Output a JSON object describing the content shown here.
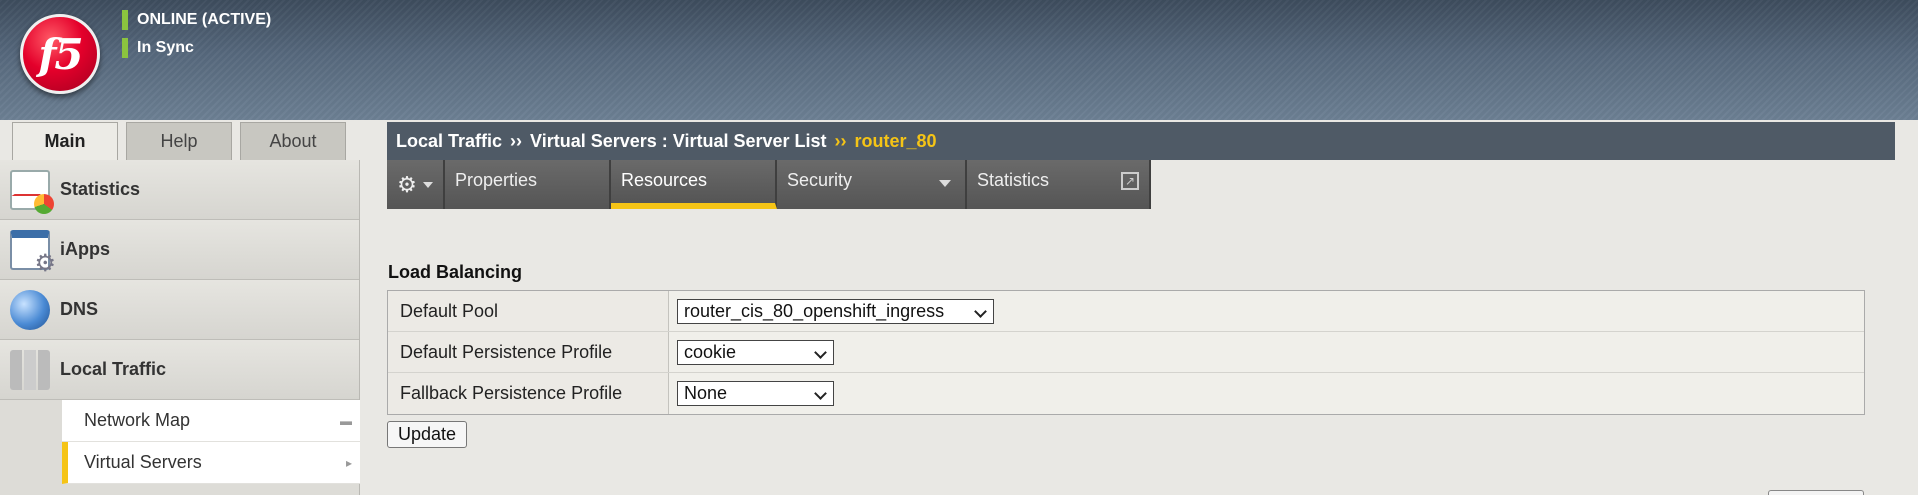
{
  "header": {
    "status_online": "ONLINE (ACTIVE)",
    "status_sync": "In Sync",
    "logo_text": "f5"
  },
  "top_tabs": [
    {
      "label": "Main",
      "active": true
    },
    {
      "label": "Help",
      "active": false
    },
    {
      "label": "About",
      "active": false
    }
  ],
  "sidebar": {
    "items": [
      {
        "label": "Statistics",
        "icon": "statistics-icon"
      },
      {
        "label": "iApps",
        "icon": "iapps-icon"
      },
      {
        "label": "DNS",
        "icon": "dns-globe-icon"
      },
      {
        "label": "Local Traffic",
        "icon": "local-traffic-icon"
      }
    ],
    "sub_items": [
      {
        "label": "Network Map"
      },
      {
        "label": "Virtual Servers"
      }
    ]
  },
  "breadcrumb": {
    "part1": "Local Traffic",
    "sep": "››",
    "part2": "Virtual Servers : Virtual Server List",
    "current": "router_80"
  },
  "subnav": {
    "properties": "Properties",
    "resources": "Resources",
    "security": "Security",
    "statistics": "Statistics"
  },
  "load_balancing": {
    "title": "Load Balancing",
    "rows": [
      {
        "label": "Default Pool",
        "value": "router_cis_80_openshift_ingress"
      },
      {
        "label": "Default Persistence Profile",
        "value": "cookie"
      },
      {
        "label": "Fallback Persistence Profile",
        "value": "None"
      }
    ],
    "update_label": "Update"
  },
  "colors": {
    "accent": "#f5c416",
    "status_green": "#8bc43f",
    "breadcrumb_bg": "#4f5a66"
  }
}
